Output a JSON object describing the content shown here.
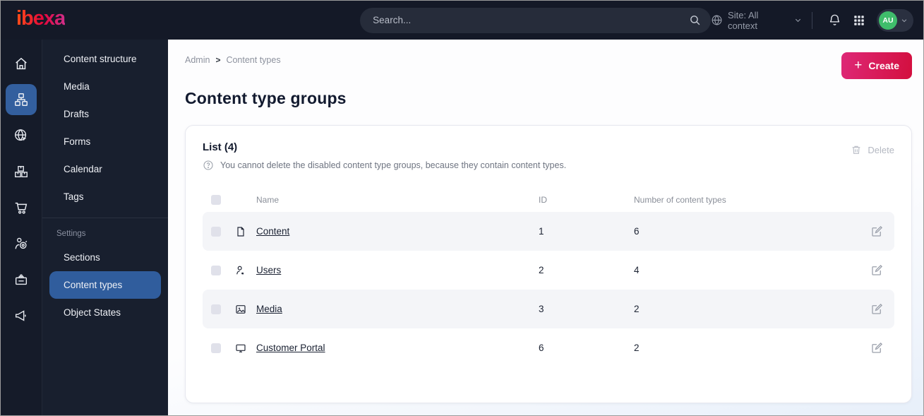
{
  "topbar": {
    "logo_text": "ibexa",
    "search_placeholder": "Search...",
    "site_selector_label": "Site: All context",
    "avatar_initials": "AU"
  },
  "rail": {
    "items": [
      "home",
      "content-tree",
      "site",
      "products",
      "commerce",
      "personalization",
      "admin",
      "campaign"
    ],
    "active": "content-tree"
  },
  "sidebar": {
    "items": [
      "Content structure",
      "Media",
      "Drafts",
      "Forms",
      "Calendar",
      "Tags"
    ],
    "section_label": "Settings",
    "settings_items": [
      "Sections",
      "Content types",
      "Object States"
    ],
    "active_item": "Content types"
  },
  "breadcrumb": {
    "items": [
      "Admin",
      "Content types"
    ],
    "separator": ">"
  },
  "page": {
    "title": "Content type groups",
    "create_label": "Create",
    "create_plus": "+"
  },
  "list": {
    "heading": "List (4)",
    "help_text": "You cannot delete the disabled content type groups, because they contain content types.",
    "delete_label": "Delete",
    "columns": {
      "name": "Name",
      "id": "ID",
      "count": "Number of content types"
    },
    "rows": [
      {
        "name": "Content",
        "id": "1",
        "count": "6",
        "icon": "file"
      },
      {
        "name": "Users",
        "id": "2",
        "count": "4",
        "icon": "user"
      },
      {
        "name": "Media",
        "id": "3",
        "count": "2",
        "icon": "image"
      },
      {
        "name": "Customer Portal",
        "id": "6",
        "count": "2",
        "icon": "monitor"
      }
    ]
  },
  "colors": {
    "topbar_bg": "#141927",
    "sidebar_bg": "#181f2e",
    "active_blue": "#335f9e",
    "brand_gradient_start": "#ff4e17",
    "brand_gradient_end": "#cf2f8a",
    "create_gradient_start": "#de2877",
    "create_gradient_end": "#d30f3e",
    "avatar_green": "#3fbd6b",
    "row_shade": "#f4f5f8"
  }
}
